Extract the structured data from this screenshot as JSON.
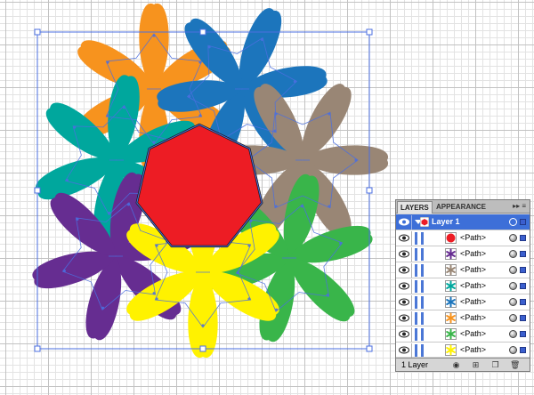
{
  "app": "Adobe Illustrator",
  "canvas": {
    "colors": {
      "orange": "#F7931E",
      "blue": "#1C75BC",
      "teal": "#00A79D",
      "taupe": "#998675",
      "purple": "#662D91",
      "yellow": "#FFF200",
      "green": "#39B54A",
      "red": "#ED1C24",
      "selection": "#4B6FE0"
    },
    "flowers": [
      {
        "name": "orange-flower",
        "color": "orange"
      },
      {
        "name": "blue-flower",
        "color": "blue"
      },
      {
        "name": "teal-flower",
        "color": "teal"
      },
      {
        "name": "taupe-flower",
        "color": "taupe"
      },
      {
        "name": "purple-flower",
        "color": "purple"
      },
      {
        "name": "yellow-flower",
        "color": "yellow"
      },
      {
        "name": "green-flower",
        "color": "green"
      }
    ],
    "center_shape": {
      "type": "heptagon",
      "color": "red"
    }
  },
  "layers_panel": {
    "tabs": [
      "LAYERS",
      "APPEARANCE"
    ],
    "menu_icon": "panel-menu-icon",
    "layer": {
      "label": "Layer 1",
      "thumb_color": "#ED1C24"
    },
    "paths": [
      {
        "label": "<Path>",
        "thumb": "heptagon",
        "color": "#ED1C24"
      },
      {
        "label": "<Path>",
        "thumb": "flower",
        "color": "#662D91"
      },
      {
        "label": "<Path>",
        "thumb": "flower",
        "color": "#998675"
      },
      {
        "label": "<Path>",
        "thumb": "flower",
        "color": "#00A79D"
      },
      {
        "label": "<Path>",
        "thumb": "flower",
        "color": "#1C75BC"
      },
      {
        "label": "<Path>",
        "thumb": "flower",
        "color": "#F7931E"
      },
      {
        "label": "<Path>",
        "thumb": "flower",
        "color": "#39B54A"
      },
      {
        "label": "<Path>",
        "thumb": "flower",
        "color": "#FFF200"
      }
    ],
    "footer": {
      "count_label": "1 Layer",
      "buttons": [
        "make-clipping-mask-icon",
        "create-sublayer-icon",
        "new-layer-icon",
        "delete-layer-icon"
      ]
    }
  }
}
